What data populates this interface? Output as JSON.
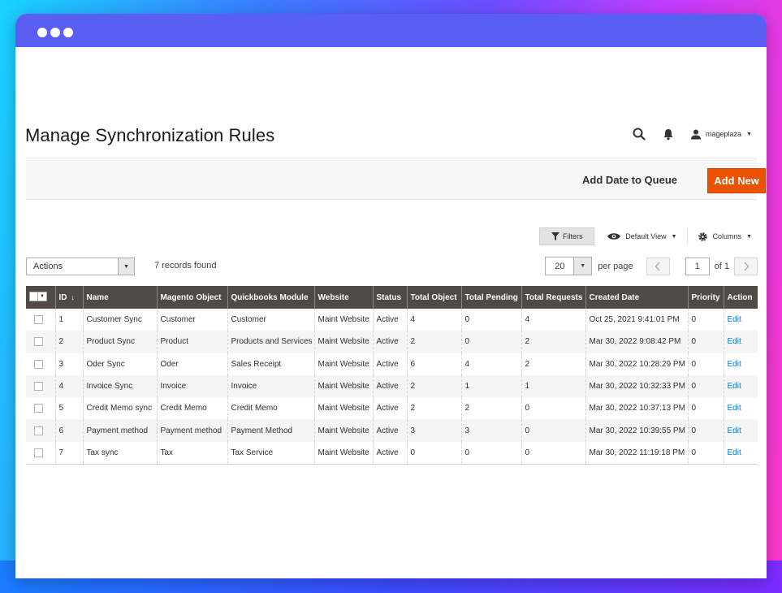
{
  "page": {
    "title": "Manage Synchronization Rules"
  },
  "header": {
    "user_name": "mageplaza"
  },
  "action_bar": {
    "add_queue_label": "Add Date to Queue",
    "add_new_label": "Add New",
    "add_new_color": "#eb5202"
  },
  "grid_tools": {
    "filters_label": "Filters",
    "view_label": "Default View",
    "columns_label": "Columns"
  },
  "mass_actions": {
    "label": "Actions"
  },
  "records_found": "7 records found",
  "pager": {
    "per_page_value": "20",
    "per_page_label": "per page",
    "current_page": "1",
    "of_label": "of 1"
  },
  "table": {
    "columns": [
      "ID",
      "Name",
      "Magento Object",
      "Quickbooks Module",
      "Website",
      "Status",
      "Total Object",
      "Total Pending",
      "Total Requests",
      "Created Date",
      "Priority",
      "Action"
    ],
    "header_color": "#514943",
    "rows": [
      {
        "id": "1",
        "name": "Customer Sync",
        "magento_object": "Customer",
        "qb_module": "Customer",
        "website": "Maint Website",
        "status": "Active",
        "total_object": "4",
        "total_pending": "0",
        "total_requests": "4",
        "created": "Oct 25, 2021 9:41:01 PM",
        "priority": "0",
        "action": "Edit"
      },
      {
        "id": "2",
        "name": "Product Sync",
        "magento_object": "Product",
        "qb_module": "Products and Services",
        "website": "Maint Website",
        "status": "Active",
        "total_object": "2",
        "total_pending": "0",
        "total_requests": "2",
        "created": "Mar 30, 2022 9:08:42 PM",
        "priority": "0",
        "action": "Edit"
      },
      {
        "id": "3",
        "name": "Oder Sync",
        "magento_object": "Oder",
        "qb_module": "Sales Receipt",
        "website": "Maint Website",
        "status": "Active",
        "total_object": "6",
        "total_pending": "4",
        "total_requests": "2",
        "created": "Mar 30, 2022 10:28:29 PM",
        "priority": "0",
        "action": "Edit"
      },
      {
        "id": "4",
        "name": "Invoice Sync",
        "magento_object": "Invoice",
        "qb_module": "Invoice",
        "website": "Maint Website",
        "status": "Active",
        "total_object": "2",
        "total_pending": "1",
        "total_requests": "1",
        "created": "Mar 30, 2022 10:32:33 PM",
        "priority": "0",
        "action": "Edit"
      },
      {
        "id": "5",
        "name": "Credit Memo sync",
        "magento_object": "Credit Memo",
        "qb_module": "Credit Memo",
        "website": "Maint Website",
        "status": "Active",
        "total_object": "2",
        "total_pending": "2",
        "total_requests": "0",
        "created": "Mar 30, 2022 10:37:13 PM",
        "priority": "0",
        "action": "Edit"
      },
      {
        "id": "6",
        "name": "Payment method",
        "magento_object": "Payment method",
        "qb_module": "Payment Method",
        "website": "Maint Website",
        "status": "Active",
        "total_object": "3",
        "total_pending": "3",
        "total_requests": "0",
        "created": "Mar 30, 2022 10:39:55 PM",
        "priority": "0",
        "action": "Edit"
      },
      {
        "id": "7",
        "name": "Tax sync",
        "magento_object": "Tax",
        "qb_module": "Tax Service",
        "website": "Maint Website",
        "status": "Active",
        "total_object": "0",
        "total_pending": "0",
        "total_requests": "0",
        "created": "Mar 30, 2022 11:19:18 PM",
        "priority": "0",
        "action": "Edit"
      }
    ]
  }
}
